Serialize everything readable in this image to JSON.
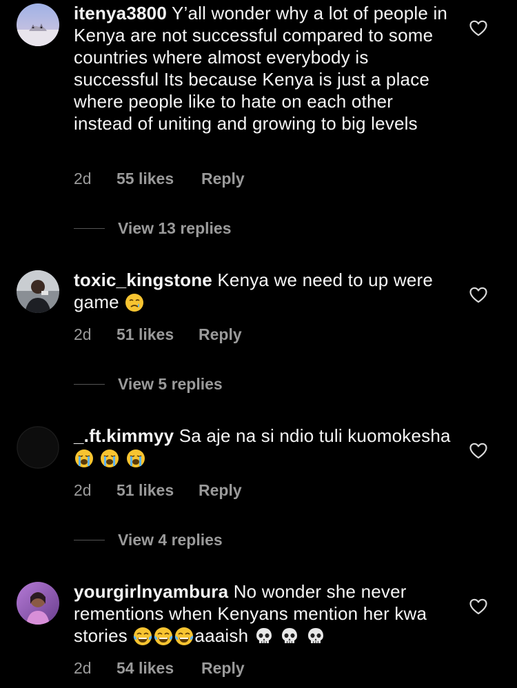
{
  "comments": [
    {
      "username": "itenya3800",
      "text": "Y’all wonder why a lot of people in Kenya are not successful compared to some countries where almost everybody is successful Its because Kenya is just a place where people like to hate on each other instead of uniting and growing to big levels",
      "time": "2d",
      "likes": "55 likes",
      "reply": "Reply",
      "view_replies": "View 13 replies"
    },
    {
      "username": "toxic_kingstone",
      "text": "Kenya we need to up were game",
      "time": "2d",
      "likes": "51 likes",
      "reply": "Reply",
      "view_replies": "View 5 replies"
    },
    {
      "username": "_.ft.kimmyy",
      "text": "Sa aje na si ndio tuli kuomokesha",
      "time": "2d",
      "likes": "51 likes",
      "reply": "Reply",
      "view_replies": "View 4 replies"
    },
    {
      "username": "yourgirlnyambura",
      "text": "No wonder she never rementions when Kenyans mention her kwa stories",
      "text_tail": "aaaish",
      "time": "2d",
      "likes": "54 likes",
      "reply": "Reply"
    }
  ],
  "colors": {
    "background": "#000000",
    "primary_text": "#f5f5f5",
    "secondary_text": "#9a9a9a"
  },
  "icons": [
    "heart-outline-icon",
    "crying-face-emoji",
    "loudly-crying-face-emoji",
    "tears-of-joy-emoji",
    "skull-emoji"
  ]
}
